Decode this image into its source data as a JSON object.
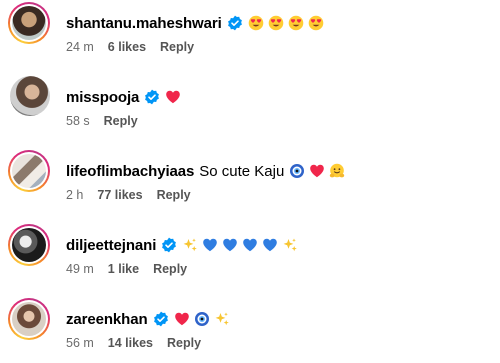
{
  "comments": [
    {
      "username": "shantanu.maheshwari",
      "verified": true,
      "text": "",
      "emojis": [
        "heart-eyes-icon",
        "heart-eyes-icon",
        "heart-eyes-icon",
        "heart-eyes-icon"
      ],
      "time": "24 m",
      "likes": "6 likes",
      "reply": "Reply"
    },
    {
      "username": "misspooja",
      "verified": true,
      "text": "",
      "emojis": [
        "red-heart-icon"
      ],
      "time": "58 s",
      "likes": "",
      "reply": "Reply"
    },
    {
      "username": "lifeoflimbachyiaas",
      "verified": false,
      "text": "So cute Kaju",
      "emojis": [
        "nazar-amulet-icon",
        "red-heart-icon",
        "hugging-face-icon"
      ],
      "time": "2 h",
      "likes": "77 likes",
      "reply": "Reply"
    },
    {
      "username": "diljeettejnani",
      "verified": true,
      "text": "",
      "emojis": [
        "sparkles-icon",
        "blue-heart-icon",
        "blue-heart-icon",
        "blue-heart-icon",
        "blue-heart-icon",
        "sparkles-icon"
      ],
      "time": "49 m",
      "likes": "1 like",
      "reply": "Reply"
    },
    {
      "username": "zareenkhan",
      "verified": true,
      "text": "",
      "emojis": [
        "red-heart-icon",
        "nazar-amulet-icon",
        "sparkles-icon"
      ],
      "time": "56 m",
      "likes": "14 likes",
      "reply": "Reply"
    }
  ],
  "colors": {
    "verified_blue": "#0095f6",
    "meta_gray": "#555555",
    "red_heart": "#f0264b",
    "blue_heart": "#2f7de1"
  }
}
